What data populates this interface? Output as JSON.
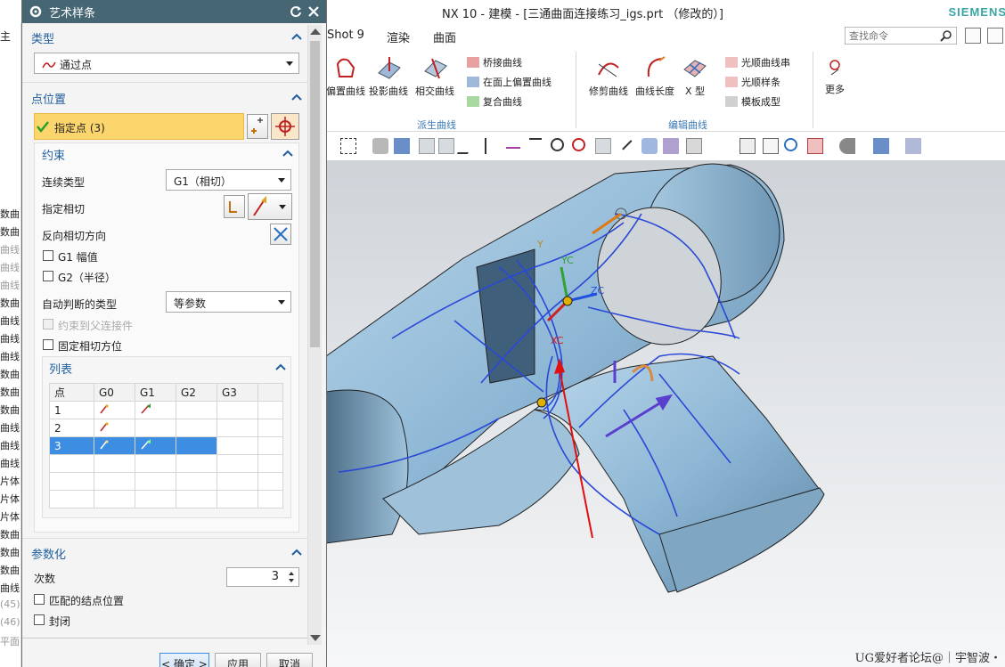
{
  "app": {
    "title": "NX 10 - 建模 - [三通曲面连接练习_igs.prt （修改的）]",
    "brand": "SIEMENS",
    "brand_color": "#3aa6a4"
  },
  "menu_tabs": [
    "Shot 9",
    "渲染",
    "曲面"
  ],
  "left_partial_tab": "主",
  "search": {
    "placeholder": "查找命令"
  },
  "ribbon": {
    "buttons_left": [
      "偏置曲线",
      "投影曲线",
      "相交曲线"
    ],
    "list_derived": [
      "桥接曲线",
      "在面上偏置曲线",
      "复合曲线"
    ],
    "group_derived": "派生曲线",
    "buttons_edit": [
      "修剪曲线",
      "曲线长度",
      "X 型"
    ],
    "list_edit": [
      "光顺曲线串",
      "光顺样条",
      "模板成型"
    ],
    "group_edit": "编辑曲线",
    "more": "更多"
  },
  "left_strip": {
    "items": [
      "数曲",
      "数曲",
      "曲线",
      "曲线",
      "曲线",
      "数曲",
      "曲线",
      "曲线",
      "曲线",
      "数曲",
      "数曲",
      "数曲",
      "曲线",
      "曲线",
      "曲线",
      "片体",
      "片体",
      "片体",
      "数曲",
      "数曲",
      "数曲",
      "曲线",
      "(45)",
      "(46)",
      "平面"
    ]
  },
  "dialog": {
    "title": "艺术样条",
    "type_section": "类型",
    "type_value": "通过点",
    "point_section": "点位置",
    "specify_point": "指定点 (3)",
    "constraint_section": "约束",
    "continuity_label": "连续类型",
    "continuity_value": "G1（相切）",
    "tangent_label": "指定相切",
    "reverse_label": "反向相切方向",
    "g1_mag": "G1 幅值",
    "g2_radius": "G2（半径）",
    "auto_type_label": "自动判断的类型",
    "auto_type_value": "等参数",
    "constrain_parent": "约束到父连接件",
    "fixed_tangent": "固定相切方位",
    "list_section": "列表",
    "table_headers": [
      "点",
      "G0",
      "G1",
      "G2",
      "G3"
    ],
    "table_rows": [
      {
        "point": "1",
        "g1": true
      },
      {
        "point": "2",
        "g1": false
      },
      {
        "point": "3",
        "g1": true
      }
    ],
    "param_section": "参数化",
    "degree_label": "次数",
    "degree_value": "3",
    "match_knots": "匹配的结点位置",
    "closed": "封闭",
    "ok": "< 确定 >",
    "apply": "应用",
    "cancel": "取消",
    "header_color": "#466674",
    "accent_color": "#1f5f9e",
    "highlight_color": "#fcd56d",
    "selection_color": "#3d8ee3"
  },
  "viewport": {
    "axis_y": "Y",
    "axis_yc": "YC",
    "axis_zc": "ZC",
    "axis_xc": "XC",
    "watermark": "UG爱好者论坛@｜宇智波・"
  }
}
